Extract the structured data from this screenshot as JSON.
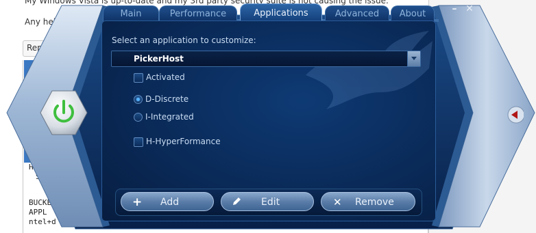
{
  "background_page": {
    "top_line": "My Windows Vista is up-to-date and my 3rd party security suite is not causing the issue.",
    "help_line": "Any help",
    "reply_button": "Rep",
    "code_lines": [
      "BUCKET",
      "  APPL",
      "ntel+d"
    ],
    "side_chars": [
      "H",
      "S"
    ]
  },
  "tabs": [
    {
      "label": "Main",
      "active": false
    },
    {
      "label": "Performance",
      "active": false
    },
    {
      "label": "Applications",
      "active": true
    },
    {
      "label": "Advanced",
      "active": false
    },
    {
      "label": "About",
      "active": false
    }
  ],
  "window": {
    "minimize": "–",
    "close": "✕"
  },
  "applications": {
    "prompt": "Select an application to customize:",
    "selected_app": "PickerHost",
    "activated_label": "Activated",
    "activated": false,
    "gpu_modes": [
      {
        "label": "D-Discrete",
        "checked": true
      },
      {
        "label": "I-Integrated",
        "checked": false
      }
    ],
    "hyperformance_label": "H-HyperFormance",
    "hyperformance": false
  },
  "actions": {
    "add": "Add",
    "edit": "Edit",
    "remove": "Remove"
  },
  "icons": {
    "power": "power-icon",
    "add": "plus-icon",
    "edit": "pencil-icon",
    "remove": "x-icon",
    "collapse": "left-arrow-icon"
  },
  "colors": {
    "panel": "#0a2a58",
    "power_green": "#3fbf3f",
    "arrow_red": "#b01818"
  }
}
